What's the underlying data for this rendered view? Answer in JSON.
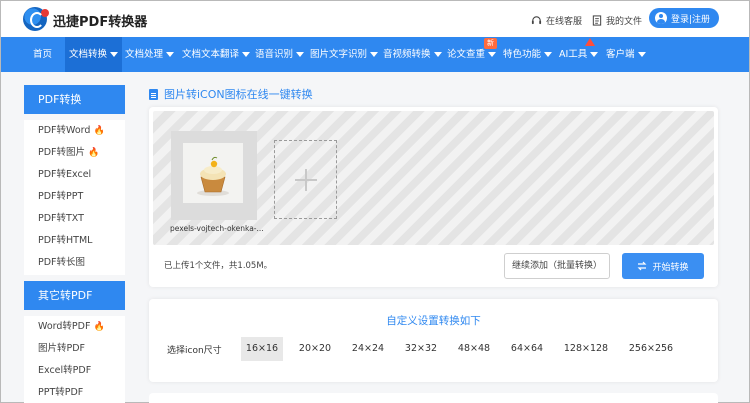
{
  "header": {
    "brand": "迅捷PDF转换器",
    "online_service": "在线客服",
    "my_files": "我的文件",
    "login": "登录|注册"
  },
  "nav": {
    "items": [
      {
        "label": "首页"
      },
      {
        "label": "文档转换"
      },
      {
        "label": "文档处理"
      },
      {
        "label": "文档文本翻译"
      },
      {
        "label": "语音识别"
      },
      {
        "label": "图片文字识别"
      },
      {
        "label": "音视频转换"
      },
      {
        "label": "论文查重"
      },
      {
        "label": "特色功能"
      },
      {
        "label": "AI工具"
      },
      {
        "label": "客户端"
      }
    ],
    "new_badge": "新"
  },
  "sidebar": {
    "pdf_section": {
      "title": "PDF转换",
      "items": [
        "PDF转Word",
        "PDF转图片",
        "PDF转Excel",
        "PDF转PPT",
        "PDF转TXT",
        "PDF转HTML",
        "PDF转长图"
      ]
    },
    "other_section": {
      "title": "其它转PDF",
      "items": [
        "Word转PDF",
        "图片转PDF",
        "Excel转PDF",
        "PPT转PDF"
      ]
    }
  },
  "main": {
    "title": "图片转iCON图标在线一键转换",
    "file_name": "pexels-vojtech-okenka-...",
    "upload_info": "已上传1个文件，共1.05M。",
    "continue_button": "继续添加（批量转换）",
    "start_button": "开始转换"
  },
  "settings": {
    "title": "自定义设置转换如下",
    "size_label": "选择icon尺寸",
    "sizes": [
      "16×16",
      "20×20",
      "24×24",
      "32×32",
      "48×48",
      "64×64",
      "128×128",
      "256×256"
    ],
    "selected": "16×16"
  },
  "colors": {
    "primary": "#2f88f0",
    "hot": "#ff6a2a"
  }
}
